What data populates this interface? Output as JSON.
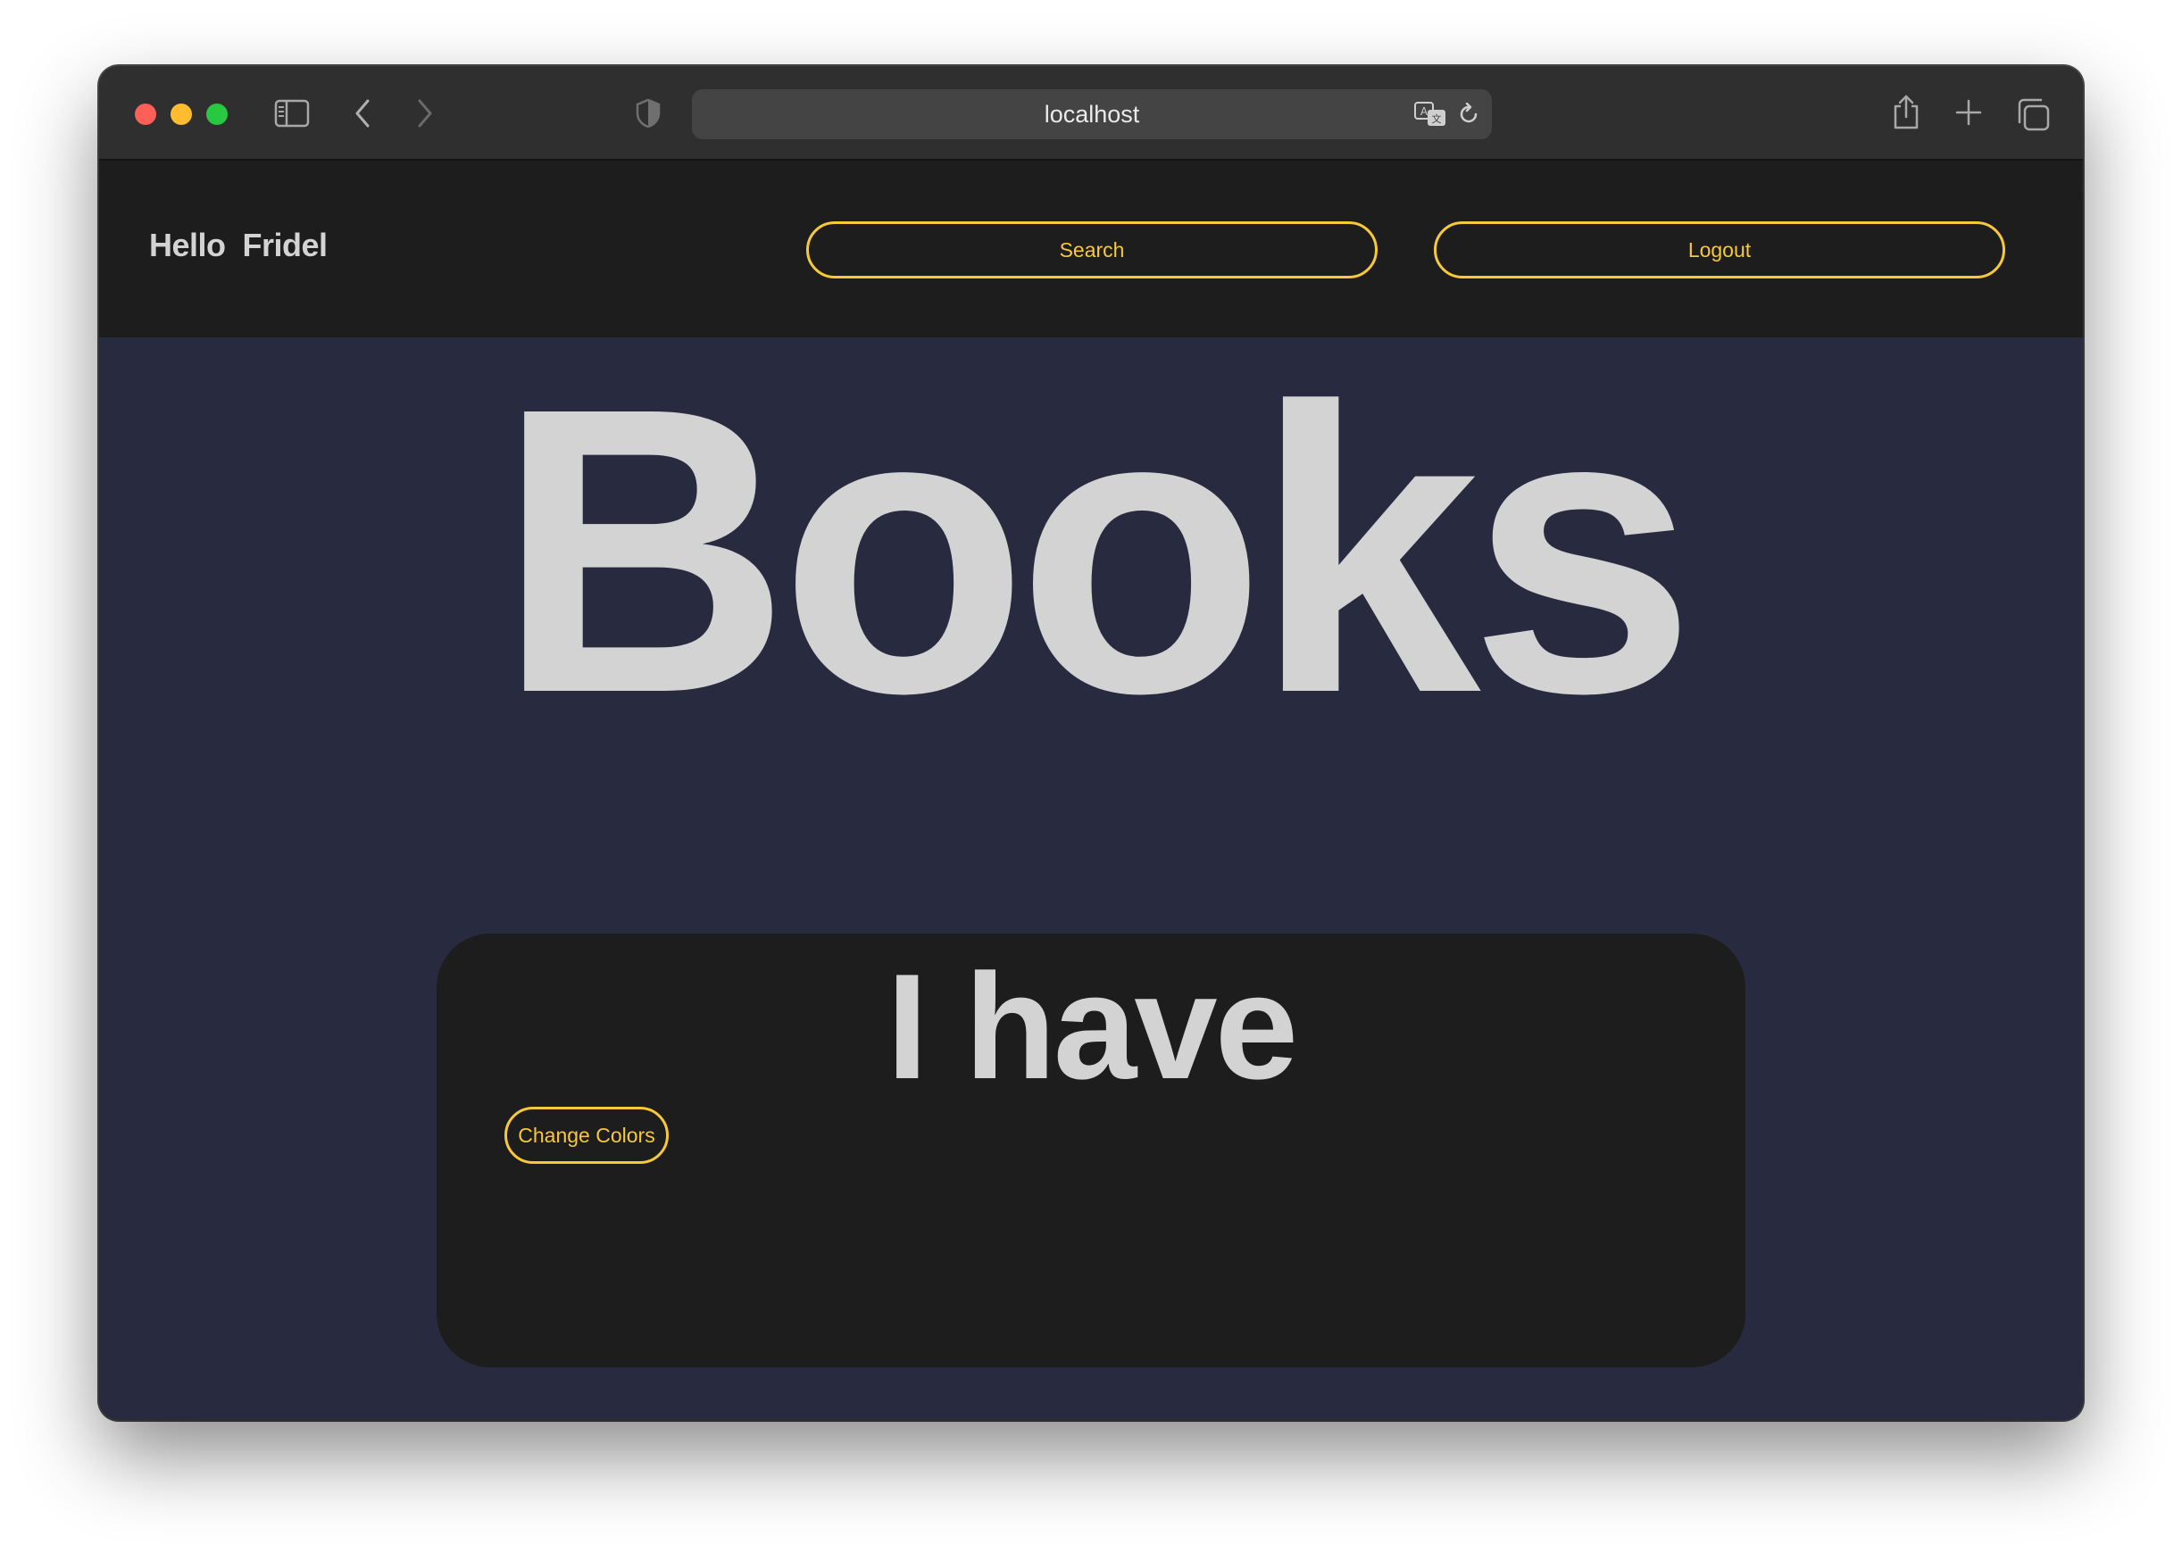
{
  "browser": {
    "url": "localhost",
    "icons": {
      "sidebar": "sidebar-icon",
      "back": "chevron-left-icon",
      "forward": "chevron-right-icon",
      "privacy": "shield-icon",
      "translate": "translate-icon",
      "reload": "reload-icon",
      "share": "share-icon",
      "new_tab": "plus-icon",
      "tabs": "tabs-overview-icon"
    }
  },
  "navbar": {
    "greeting": "Hello  Fridel",
    "search_label": "Search",
    "logout_label": "Logout"
  },
  "main": {
    "title": "Books",
    "card": {
      "title": "I have",
      "change_colors_label": "Change Colors"
    }
  },
  "colors": {
    "page_background": "#282b40",
    "navbar_background": "#1d1d1d",
    "card_background": "#1d1d1d",
    "text": "#d3d3d3",
    "accent": "#f6c83a"
  }
}
